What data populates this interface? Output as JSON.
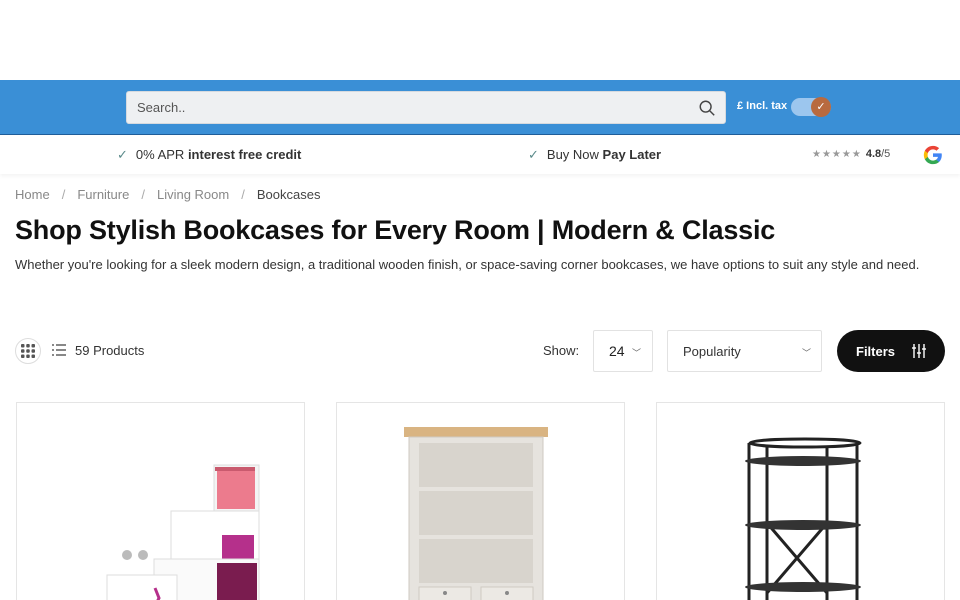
{
  "search": {
    "placeholder": "Search.."
  },
  "tax_toggle": {
    "label": "£ Incl. tax",
    "enabled": true
  },
  "usp": [
    {
      "plain": "0% APR ",
      "bold": "interest free credit"
    },
    {
      "plain": "Buy Now ",
      "bold": "Pay Later"
    }
  ],
  "rating": {
    "score": "4.8",
    "outof": "/5",
    "stars": "★★★★★"
  },
  "breadcrumb": [
    "Home",
    "Furniture",
    "Living Room",
    "Bookcases"
  ],
  "breadcrumb_sep": "/",
  "page_title": "Shop Stylish Bookcases for Every Room | Modern & Classic",
  "description": "Whether you're looking for a sleek modern design, a traditional wooden finish, or space-saving corner bookcases, we have options to suit any style and need.",
  "toolbar": {
    "product_count": "59 Products",
    "show_label": "Show:",
    "show_value": "24",
    "sort_value": "Popularity",
    "filters_label": "Filters"
  },
  "products": [
    {
      "name": "white-pink-step-bookcase"
    },
    {
      "name": "grey-oak-top-bookcase"
    },
    {
      "name": "black-metal-shelving-unit"
    }
  ],
  "colors": {
    "brand_blue": "#3a8fd6",
    "toggle_knob": "#b86a3f",
    "filters_bg": "#111111"
  }
}
